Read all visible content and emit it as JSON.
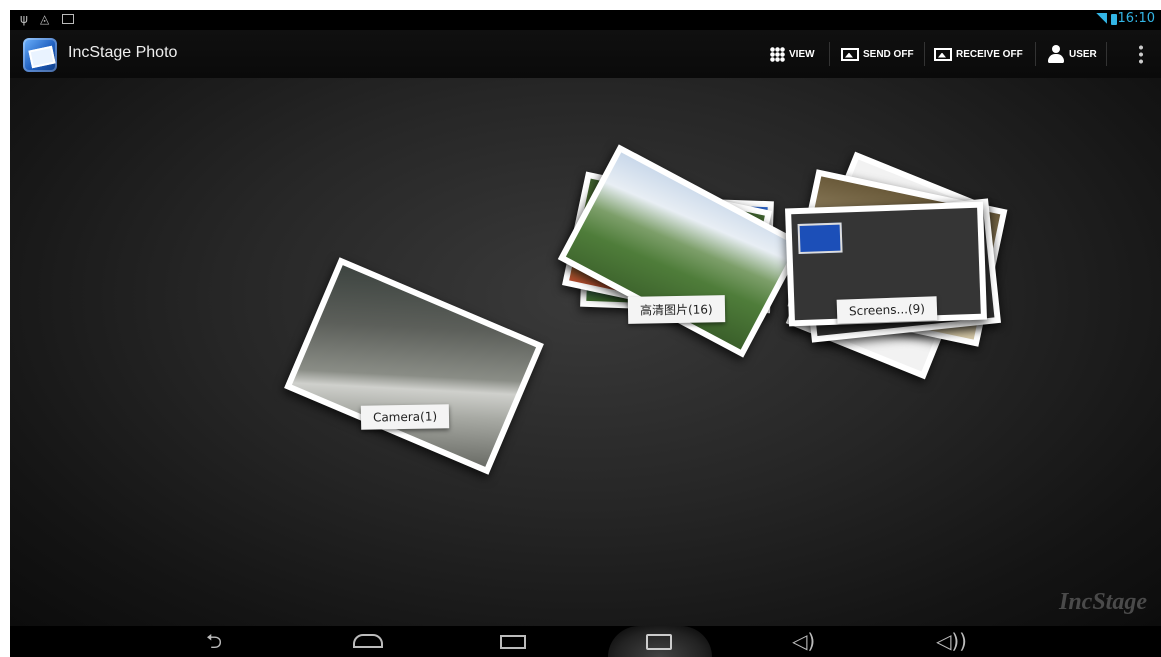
{
  "status_bar": {
    "left_icons": [
      "usb-icon",
      "wifi-icon",
      "image-notification-icon"
    ],
    "time": "16:10",
    "accent_color": "#33b5e5"
  },
  "action_bar": {
    "app_title": "IncStage Photo",
    "buttons": [
      {
        "label": "VIEW",
        "icon": "grid-icon"
      },
      {
        "label": "SEND OFF",
        "icon": "send-icon"
      },
      {
        "label": "RECEIVE OFF",
        "icon": "receive-icon"
      },
      {
        "label": "USER",
        "icon": "user-icon"
      }
    ]
  },
  "albums": [
    {
      "label": "Camera(1)"
    },
    {
      "label": "高清图片(16)"
    },
    {
      "label": "Screens...(9)"
    }
  ],
  "watermark": "IncStage",
  "nav_bar": {
    "icons": [
      "back-icon",
      "home-icon",
      "recent-apps-icon",
      "camera-icon",
      "volume-down-icon",
      "volume-up-icon"
    ]
  }
}
